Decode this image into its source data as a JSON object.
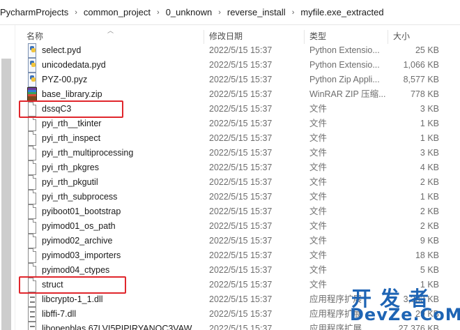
{
  "breadcrumb": [
    "PycharmProjects",
    "common_project",
    "0_unknown",
    "reverse_install",
    "myfile.exe_extracted"
  ],
  "breadcrumb_separator": "›",
  "columns": {
    "name": "名称",
    "modified": "修改日期",
    "type": "类型",
    "size": "大小"
  },
  "files": [
    {
      "name": "select.pyd",
      "modified": "2022/5/15 15:37",
      "type": "Python Extensio...",
      "size": "25 KB",
      "icon": "python-extension-icon"
    },
    {
      "name": "unicodedata.pyd",
      "modified": "2022/5/15 15:37",
      "type": "Python Extensio...",
      "size": "1,066 KB",
      "icon": "python-extension-icon"
    },
    {
      "name": "PYZ-00.pyz",
      "modified": "2022/5/15 15:37",
      "type": "Python Zip Appli...",
      "size": "8,577 KB",
      "icon": "python-extension-icon"
    },
    {
      "name": "base_library.zip",
      "modified": "2022/5/15 15:37",
      "type": "WinRAR ZIP 压缩...",
      "size": "778 KB",
      "icon": "winrar-archive-icon"
    },
    {
      "name": "dssqC3",
      "modified": "2022/5/15 15:37",
      "type": "文件",
      "size": "3 KB",
      "icon": "blank-file-icon"
    },
    {
      "name": "pyi_rth__tkinter",
      "modified": "2022/5/15 15:37",
      "type": "文件",
      "size": "1 KB",
      "icon": "blank-file-icon"
    },
    {
      "name": "pyi_rth_inspect",
      "modified": "2022/5/15 15:37",
      "type": "文件",
      "size": "1 KB",
      "icon": "blank-file-icon"
    },
    {
      "name": "pyi_rth_multiprocessing",
      "modified": "2022/5/15 15:37",
      "type": "文件",
      "size": "3 KB",
      "icon": "blank-file-icon"
    },
    {
      "name": "pyi_rth_pkgres",
      "modified": "2022/5/15 15:37",
      "type": "文件",
      "size": "4 KB",
      "icon": "blank-file-icon"
    },
    {
      "name": "pyi_rth_pkgutil",
      "modified": "2022/5/15 15:37",
      "type": "文件",
      "size": "2 KB",
      "icon": "blank-file-icon"
    },
    {
      "name": "pyi_rth_subprocess",
      "modified": "2022/5/15 15:37",
      "type": "文件",
      "size": "1 KB",
      "icon": "blank-file-icon"
    },
    {
      "name": "pyiboot01_bootstrap",
      "modified": "2022/5/15 15:37",
      "type": "文件",
      "size": "2 KB",
      "icon": "blank-file-icon"
    },
    {
      "name": "pyimod01_os_path",
      "modified": "2022/5/15 15:37",
      "type": "文件",
      "size": "2 KB",
      "icon": "blank-file-icon"
    },
    {
      "name": "pyimod02_archive",
      "modified": "2022/5/15 15:37",
      "type": "文件",
      "size": "9 KB",
      "icon": "blank-file-icon"
    },
    {
      "name": "pyimod03_importers",
      "modified": "2022/5/15 15:37",
      "type": "文件",
      "size": "18 KB",
      "icon": "blank-file-icon"
    },
    {
      "name": "pyimod04_ctypes",
      "modified": "2022/5/15 15:37",
      "type": "文件",
      "size": "5 KB",
      "icon": "blank-file-icon"
    },
    {
      "name": "struct",
      "modified": "2022/5/15 15:37",
      "type": "文件",
      "size": "1 KB",
      "icon": "blank-file-icon"
    },
    {
      "name": "libcrypto-1_1.dll",
      "modified": "2022/5/15 15:37",
      "type": "应用程序扩展",
      "size": "3,383 KB",
      "icon": "dll-file-icon"
    },
    {
      "name": "libffi-7.dll",
      "modified": "2022/5/15 15:37",
      "type": "应用程序扩展",
      "size": "29 KB",
      "icon": "dll-file-icon"
    },
    {
      "name": "libopenblas.67LVI5PIPIRYANOC3VAW...",
      "modified": "2022/5/15 15:37",
      "type": "应用程序扩展",
      "size": "27,376 KB",
      "icon": "dll-file-icon"
    }
  ],
  "highlighted_files": [
    "dssqC3",
    "struct"
  ],
  "highlight_color": "#e0262c",
  "watermark": {
    "title": "开发者",
    "subtitle": "DevZe.CoM"
  }
}
